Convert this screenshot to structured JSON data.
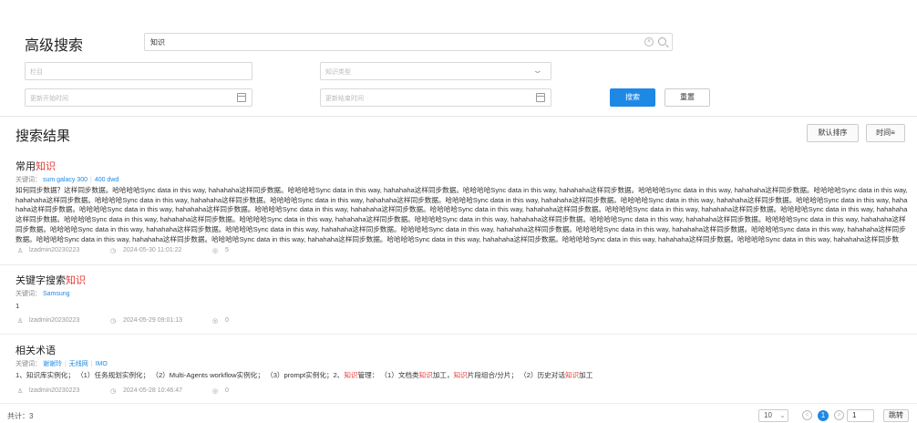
{
  "search": {
    "title": "高级搜索",
    "keyword_value": "知识",
    "clear_glyph": "×",
    "column_placeholder": "栏目",
    "type_placeholder": "知识类型",
    "start_time_placeholder": "更新开始时间",
    "end_time_placeholder": "更新结束时间",
    "search_label": "搜索",
    "reset_label": "重置"
  },
  "results_header": {
    "title": "搜索结果",
    "default_sort_label": "默认排序",
    "time_sort_label": "时间≡"
  },
  "results": [
    {
      "title_prefix": "常用",
      "title_highlight": "知识",
      "keywords_label": "关键词：",
      "tags": [
        "sum galacy 300",
        "400 dwd"
      ],
      "body_start": "如何同步数据？这样同步数据。",
      "body_repeat": "哈哈哈哈Sync data in this way, hahahaha这样同步数据。",
      "author": "lzadmin20230223",
      "time": "2024-05-30 11:01:22",
      "views": "5"
    },
    {
      "title_prefix": "关键字搜索",
      "title_highlight": "知识",
      "keywords_label": "关键词：",
      "tags": [
        "Samsung"
      ],
      "body": "1",
      "author": "lzadmin20230223",
      "time": "2024-05-29 09:01:13",
      "views": "0"
    },
    {
      "title_prefix": "相关术语",
      "title_highlight": "",
      "keywords_label": "关键词：",
      "tags": [
        "谢谢玲",
        "无线网",
        "IMO"
      ],
      "body_parts": [
        {
          "t": "1、知识库实例化； （1）任务规划实例化； （2）Multi-Agents workflow实例化； （3）prompt实例化；2、",
          "hl": false
        },
        {
          "t": "知识",
          "hl": true
        },
        {
          "t": "管理： （1）文档类",
          "hl": false
        },
        {
          "t": "知识",
          "hl": true
        },
        {
          "t": "加工，",
          "hl": false
        },
        {
          "t": "知识",
          "hl": true
        },
        {
          "t": "片段组合/分片； （2）历史对话",
          "hl": false
        },
        {
          "t": "知识",
          "hl": true
        },
        {
          "t": "加工",
          "hl": false
        }
      ],
      "author": "lzadmin20230223",
      "time": "2024-05-28 10:46:47",
      "views": "0"
    }
  ],
  "footer": {
    "total": "共计：3",
    "page_size": "10",
    "prev": "<",
    "current_page": "1",
    "next": ">",
    "jump_value": "1",
    "jump_label": "跳转"
  },
  "colors": {
    "primary": "#1e88e5",
    "highlight": "#e53935"
  },
  "icons": [
    "clear-icon",
    "search-icon",
    "chevron-down-icon",
    "calendar-icon",
    "user-icon",
    "clock-icon",
    "eye-icon"
  ]
}
